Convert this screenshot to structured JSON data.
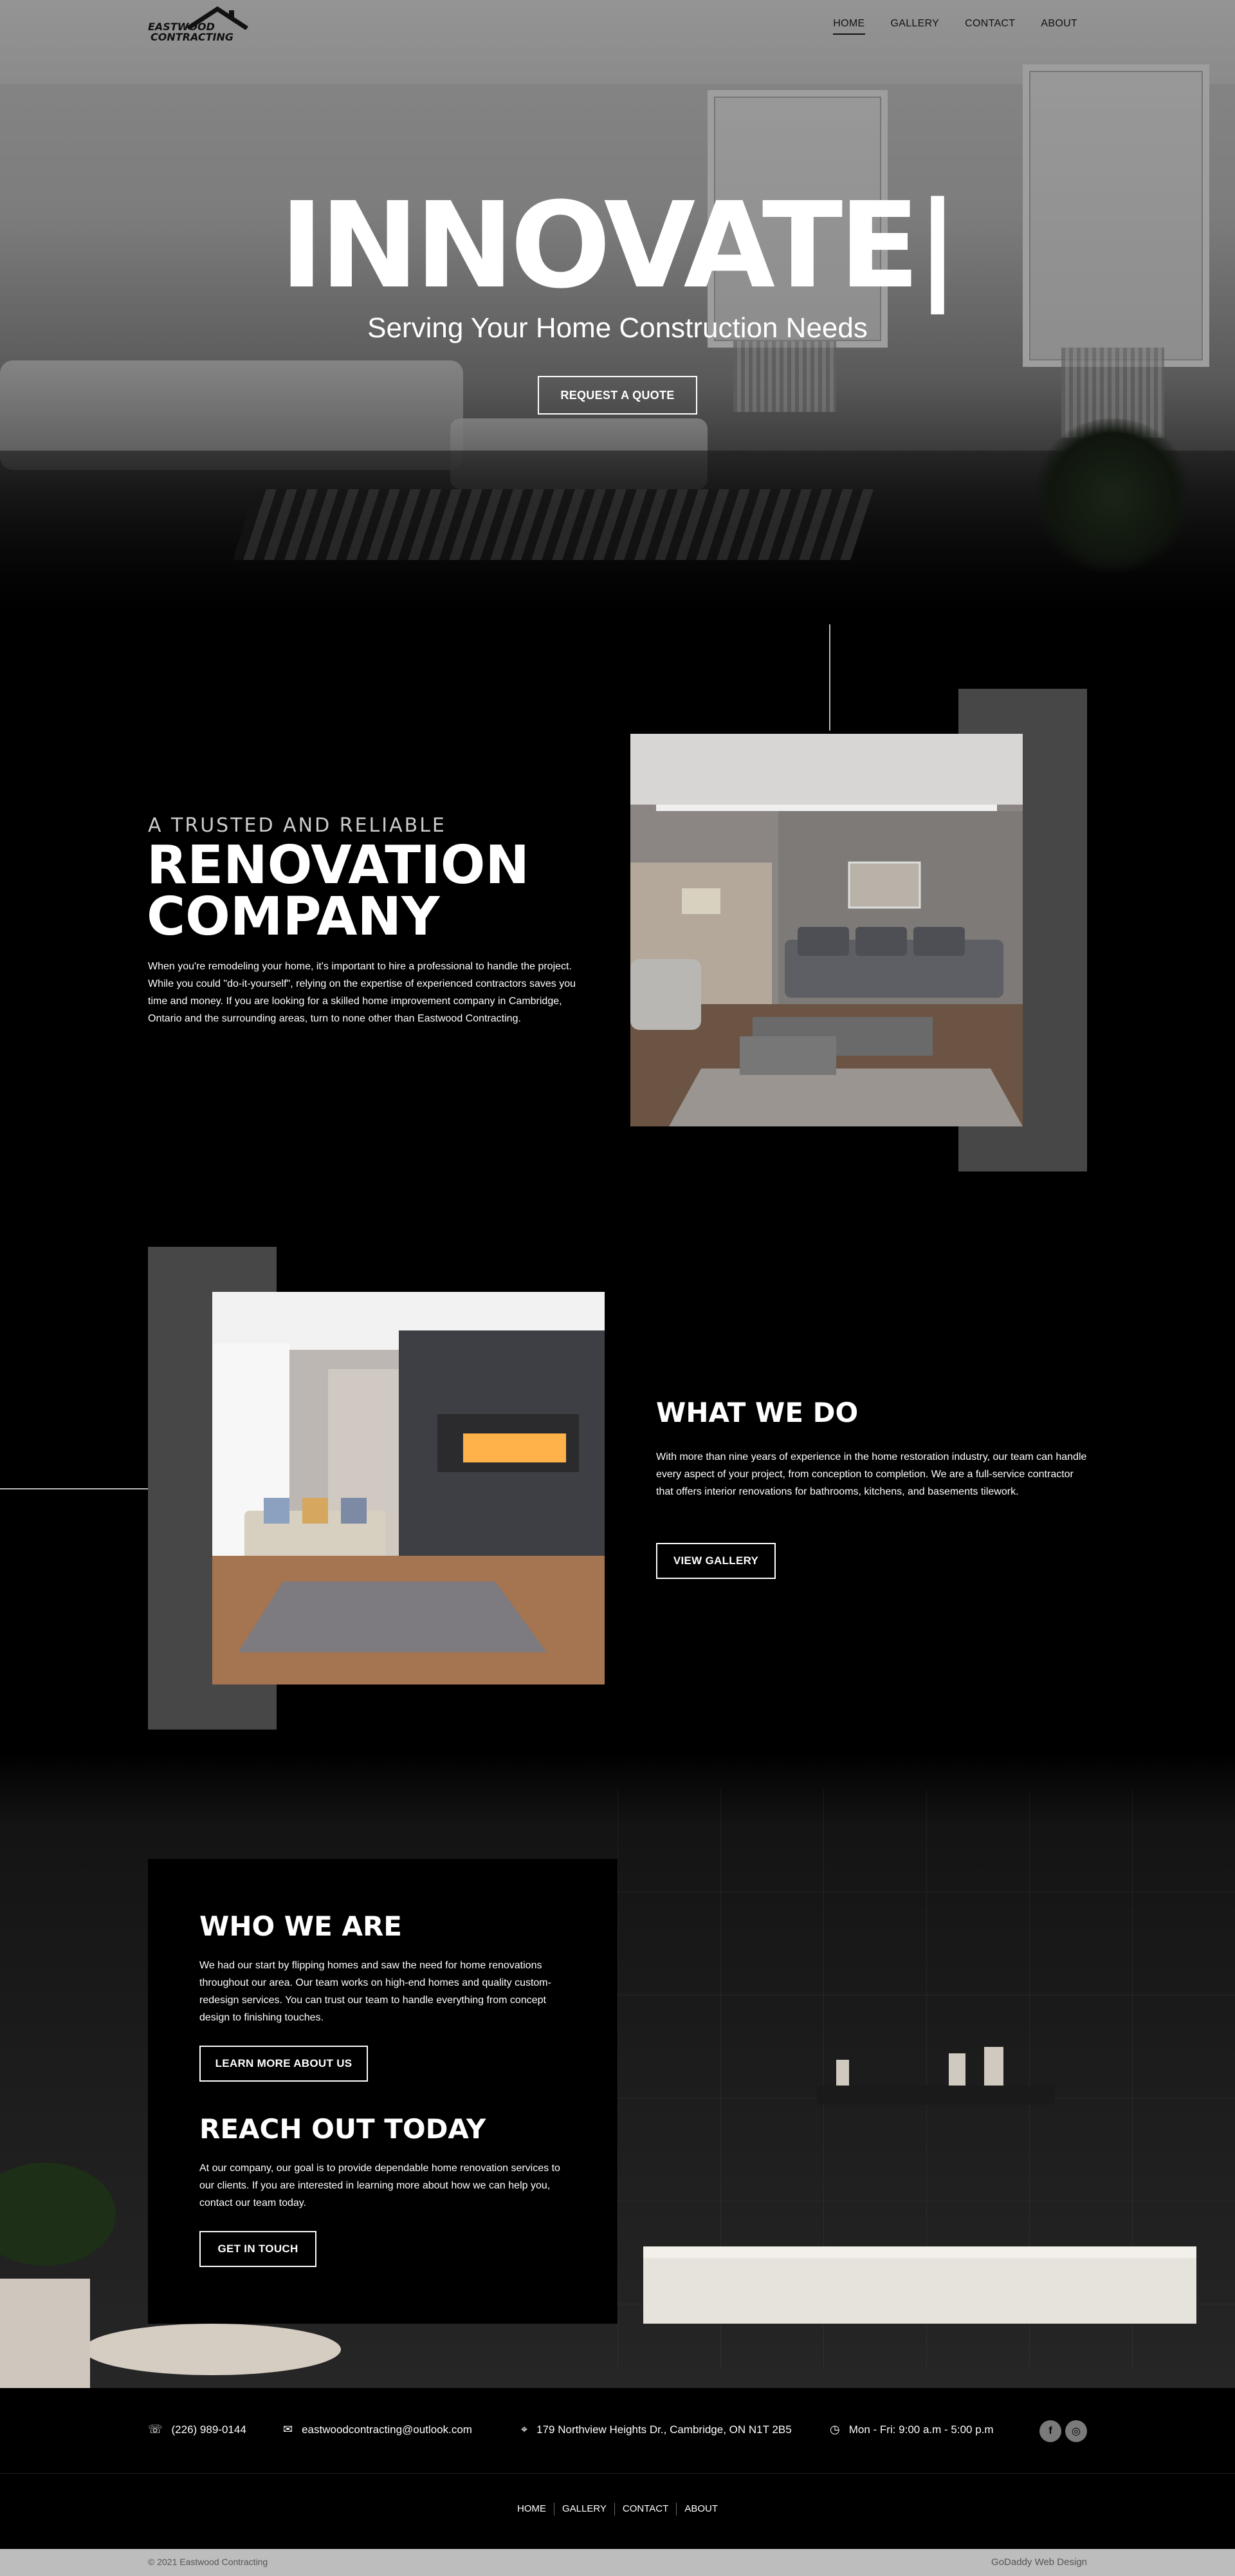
{
  "nav": {
    "logo_line1": "EASTWOOD",
    "logo_line2": "CONTRACTING",
    "items": [
      {
        "label": "HOME",
        "active": true
      },
      {
        "label": "GALLERY",
        "active": false
      },
      {
        "label": "CONTACT",
        "active": false
      },
      {
        "label": "ABOUT",
        "active": false
      }
    ]
  },
  "hero": {
    "title": "INNOVATE|",
    "subtitle": "Serving Your Home Construction Needs",
    "cta": "REQUEST A QUOTE"
  },
  "intro": {
    "eyebrow": "A TRUSTED AND RELIABLE",
    "title_line1": "RENOVATION",
    "title_line2": "COMPANY",
    "body": "When you're remodeling your home, it's important to hire a professional to handle the project. While you could \"do-it-yourself\", relying on the expertise of experienced contractors saves you time and money. If you are looking for a skilled home improvement company in Cambridge, Ontario and the surrounding areas, turn to none other than Eastwood Contracting."
  },
  "what_we_do": {
    "title": "WHAT WE DO",
    "body": "With more than nine years of experience in the home restoration industry, our team can handle every aspect of your project, from conception to completion. We are a full-service contractor that offers interior renovations for bathrooms, kitchens, and basements tilework.",
    "cta": "VIEW GALLERY"
  },
  "who_we_are": {
    "title": "WHO WE ARE",
    "body": "We had our start by flipping homes and saw the need for home renovations throughout our area. Our team works on high-end homes and quality custom-redesign services. You can trust our team to handle everything from concept design to finishing touches.",
    "cta": "LEARN MORE ABOUT US"
  },
  "reach_out": {
    "title": "REACH OUT TODAY",
    "body": "At our company, our goal is to provide dependable home renovation services to our clients. If you are interested in learning more about how we can help you, contact our team today.",
    "cta": "GET IN TOUCH"
  },
  "footer": {
    "phone": "(226) 989-0144",
    "email": "eastwoodcontracting@outlook.com",
    "address": "179 Northview Heights Dr., Cambridge, ON N1T 2B5",
    "hours": "Mon - Fri: 9:00 a.m - 5:00 p.m",
    "social_facebook": "f",
    "social_instagram": "◎",
    "menu": [
      "HOME",
      "GALLERY",
      "CONTACT",
      "ABOUT"
    ],
    "copyright": "© 2021 Eastwood Contracting",
    "credit": "GoDaddy Web Design"
  },
  "icons": {
    "phone": "phone-icon",
    "email": "envelope-icon",
    "address": "map-pin-icon",
    "hours": "clock-icon"
  },
  "colors": {
    "background": "#000000",
    "accent_block": "#474747",
    "copyright_bar": "#bdbdbd"
  }
}
